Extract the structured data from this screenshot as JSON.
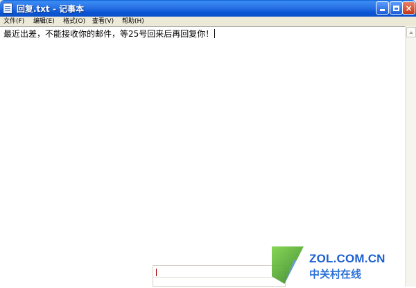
{
  "window": {
    "title": "回复.txt - 记事本",
    "buttons": {
      "minimize": "",
      "maximize": "",
      "close": "×"
    }
  },
  "menu": [
    "文件(F)",
    "编辑(E)",
    "格式(O)",
    "查看(V)",
    "帮助(H)"
  ],
  "editor": {
    "text": "最近出差，不能接收你的邮件，等25号回来后再回复你！"
  },
  "watermark": {
    "site": "ZOL.COM.CN",
    "name": "中关村在线"
  }
}
